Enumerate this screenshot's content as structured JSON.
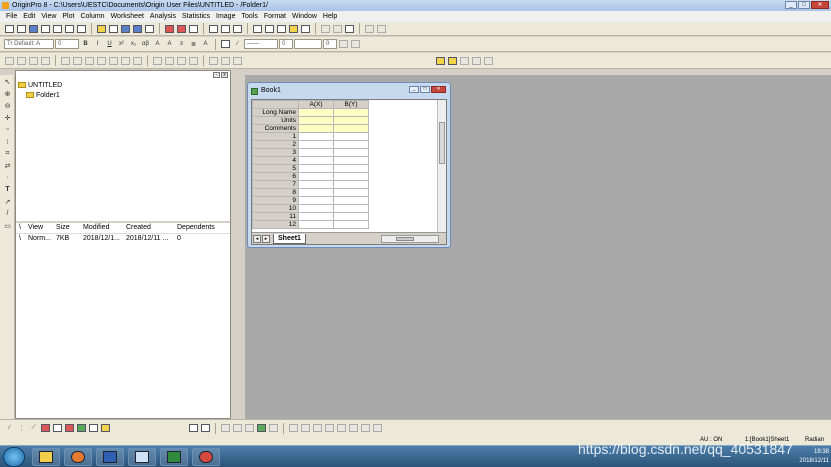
{
  "window": {
    "title": "OriginPro 8 - C:\\Users\\UESTC\\Documents\\Origin User Files\\UNTITLED - /Folder1/"
  },
  "menu": [
    "File",
    "Edit",
    "View",
    "Plot",
    "Column",
    "Worksheet",
    "Analysis",
    "Statistics",
    "Image",
    "Tools",
    "Format",
    "Window",
    "Help"
  ],
  "format_toolbar": {
    "font": "Tr Default: A",
    "size": "0",
    "bold": "B",
    "italic": "I",
    "underline": "U"
  },
  "project_explorer": {
    "root": "UNTITLED",
    "folder": "Folder1",
    "columns": [
      "View",
      "Size",
      "Modified",
      "Created",
      "Dependents"
    ],
    "rows": [
      {
        "view": "Norm...",
        "size": "7KB",
        "modified": "2018/12/1...",
        "created": "2018/12/11 ...",
        "dependents": "0"
      }
    ]
  },
  "book": {
    "title": "Book1",
    "col_a": "A(X)",
    "col_b": "B(Y)",
    "meta_rows": [
      "Long Name",
      "Units",
      "Comments"
    ],
    "rows": [
      "1",
      "2",
      "3",
      "4",
      "5",
      "6",
      "7",
      "8",
      "9",
      "10",
      "11",
      "12"
    ],
    "sheet_tab": "Sheet1"
  },
  "status": {
    "au": "AU : ON",
    "active": "1:[Book1]Sheet1",
    "units": "Radian"
  },
  "tray": {
    "time": "19:38",
    "date": "2018/12/11"
  },
  "watermark": "https://blog.csdn.net/qq_40531847",
  "colors": {
    "title_bar": "#b5cdec",
    "mdi_background": "#a9a9a9",
    "taskbar": "#2b5479",
    "yellow_cells": "#fefdc4"
  }
}
